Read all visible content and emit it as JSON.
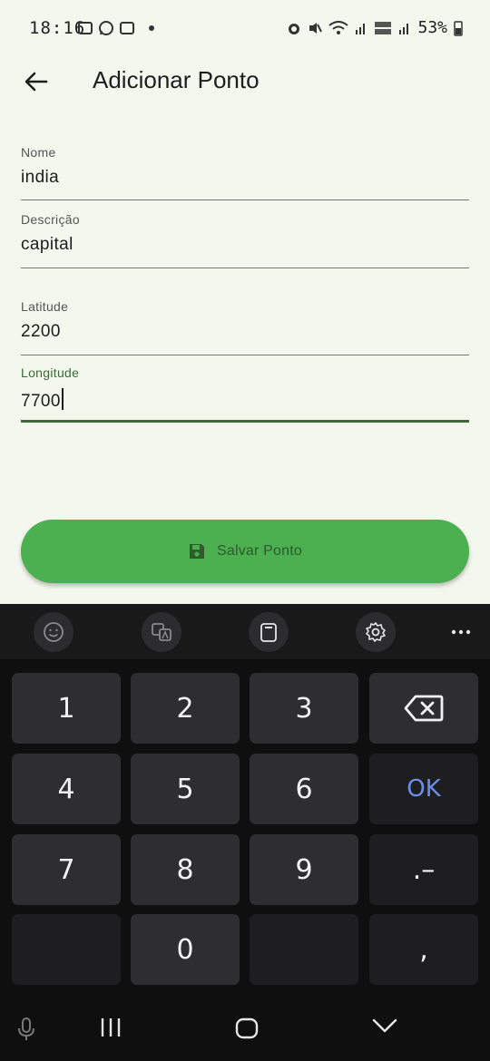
{
  "status_bar": {
    "time": "18:16",
    "battery": "53%",
    "icons": [
      "gallery-icon",
      "whatsapp-icon",
      "cast-icon",
      "alarm-icon",
      "mute-icon",
      "wifi-icon",
      "signal-icon",
      "volte-icon"
    ]
  },
  "app_bar": {
    "back_icon": "arrow-back-icon",
    "title": "Adicionar Ponto"
  },
  "form": {
    "nome": {
      "label": "Nome",
      "value": "india"
    },
    "descricao": {
      "label": "Descrição",
      "value": "capital"
    },
    "latitude": {
      "label": "Latitude",
      "value": "2200"
    },
    "longitude": {
      "label": "Longitude",
      "value": "7700"
    }
  },
  "save_button": {
    "label": "Salvar Ponto",
    "icon": "save-icon"
  },
  "keyboard": {
    "toolbar": [
      "emoji-icon",
      "translate-icon",
      "clipboard-icon",
      "settings-icon",
      "more-icon"
    ],
    "keys": {
      "k1": "1",
      "k2": "2",
      "k3": "3",
      "k4": "4",
      "k5": "5",
      "k6": "6",
      "ok": "OK",
      "k7": "7",
      "k8": "8",
      "k9": "9",
      "dot_dash": ".–",
      "k0": "0",
      "comma": ","
    }
  },
  "nav_bar": [
    "mic-icon",
    "recents-icon",
    "home-icon",
    "hide-keyboard-icon"
  ],
  "colors": {
    "background": "#f4f7ee",
    "accent": "#3b6b35",
    "button": "#4caf50",
    "ok_key": "#6d8fe6"
  }
}
